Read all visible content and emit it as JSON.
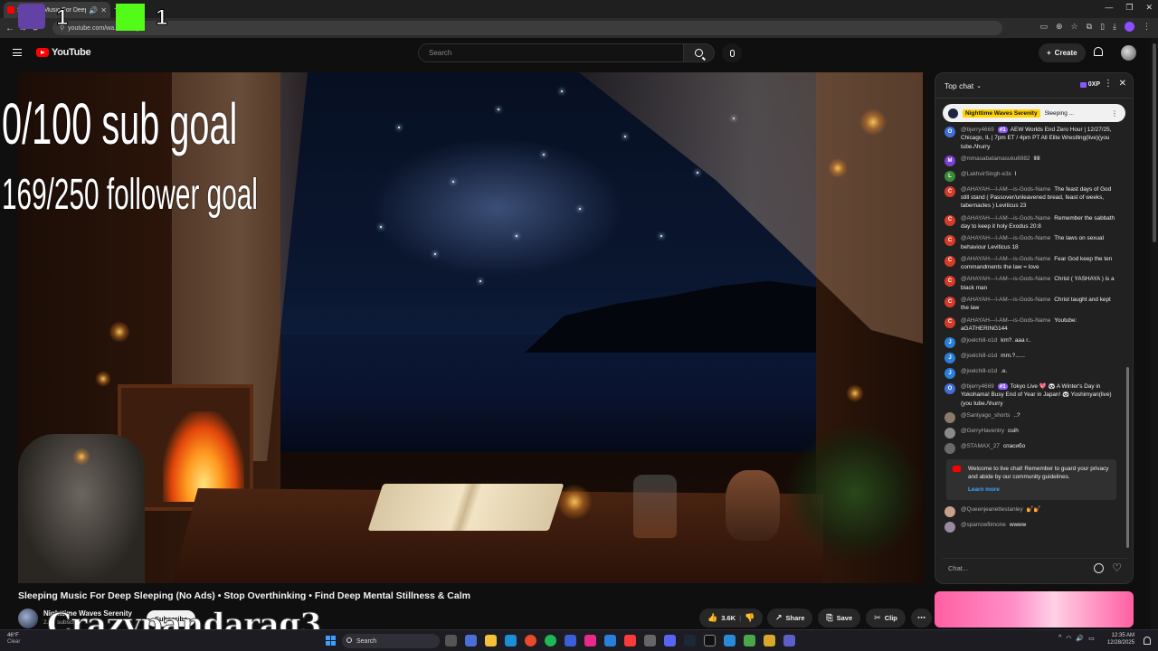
{
  "browser": {
    "tab_title": "Sleeping Music For Deep Sl",
    "url": "youtube.com/wa...UCl-i6y0",
    "window_controls": [
      "—",
      "❐",
      "✕"
    ]
  },
  "overlays": {
    "twitch_count": "1",
    "kick_count": "1",
    "sub_goal": "0/100 sub goal",
    "follower_goal": "169/250 follower goal",
    "watermark": "Crazypandarag3"
  },
  "header": {
    "logo_text": "YouTube",
    "search_placeholder": "Search",
    "create_label": "Create"
  },
  "video": {
    "title": "Sleeping Music For Deep Sleeping (No Ads) • Stop Overthinking • Find Deep Mental Stillness & Calm",
    "channel": "Nighttime Waves Serenity",
    "subscribers": "2.9K subscri",
    "subscribe_label": "Subscribe",
    "like_count": "3.6K",
    "share_label": "Share",
    "save_label": "Save",
    "clip_label": "Clip"
  },
  "chat": {
    "header_label": "Top chat",
    "xp_label": "0XP",
    "pinned": {
      "channel": "Nighttime Waves Serenity",
      "text": "Sleeping ..."
    },
    "messages": [
      {
        "initial": "O",
        "color": "#3f6fd8",
        "author": "@bjerry4669",
        "badge": "#1",
        "text": "AEW Worlds End Zero Hour | 12/27/25, Chicago, IL | 7pm ET / 4pm PT All Elite Wrestling(live)(you tube./\\hurry"
      },
      {
        "initial": "M",
        "color": "#7b3fd8",
        "author": "@mmasabatamasuku6982",
        "text": "lllll"
      },
      {
        "initial": "L",
        "color": "#3a8a3a",
        "author": "@LakhvirSingh-e3x",
        "text": "l"
      },
      {
        "initial": "C",
        "color": "#d83a2a",
        "author": "@AHAYAH---I-AM---is-Gods-Name",
        "text": "The feast days of God still stand ( Passover/unleavened bread, feast of weeks, tabernacles ) Leviticus 23"
      },
      {
        "initial": "C",
        "color": "#d83a2a",
        "author": "@AHAYAH---I-AM---is-Gods-Name",
        "text": "Remember the sabbath day to keep it holy Exodus 20:8"
      },
      {
        "initial": "C",
        "color": "#d83a2a",
        "author": "@AHAYAH---I-AM---is-Gods-Name",
        "text": "The laws on sexual behaviour Leviticus 18"
      },
      {
        "initial": "C",
        "color": "#d83a2a",
        "author": "@AHAYAH---I-AM---is-Gods-Name",
        "text": "Fear God keep the ten commandments the law = love"
      },
      {
        "initial": "C",
        "color": "#d83a2a",
        "author": "@AHAYAH---I-AM---is-Gods-Name",
        "text": "Christ ( YASHAYA ) is a black man"
      },
      {
        "initial": "C",
        "color": "#d83a2a",
        "author": "@AHAYAH---I-AM---is-Gods-Name",
        "text": "Christ taught and kept the law"
      },
      {
        "initial": "C",
        "color": "#d83a2a",
        "author": "@AHAYAH---I-AM---is-Gods-Name",
        "text": "Youtube: aGATHERING144"
      },
      {
        "initial": "J",
        "color": "#2a7fd8",
        "author": "@joelchill-o1d",
        "text": "km?. aaa r.."
      },
      {
        "initial": "J",
        "color": "#2a7fd8",
        "author": "@joelchill-o1d",
        "text": "mm.?......"
      },
      {
        "initial": "J",
        "color": "#2a7fd8",
        "author": "@joelchill-o1d",
        "text": ".e."
      },
      {
        "initial": "O",
        "color": "#3f6fd8",
        "author": "@bjerry4669",
        "badge": "#1",
        "text": "Tokyo Live 💖 🐼 A Winter's Day in Yokohama! Busy End of Year in Japan! 🐼 Yoshimyan(live)(you tube./\\hurry"
      },
      {
        "initial": "",
        "color": "#8a7a6a",
        "author": "@Santyago_shorts",
        "text": "..?"
      },
      {
        "initial": "",
        "color": "#8a8a8a",
        "author": "@GerryHaventry",
        "text": "cuih"
      },
      {
        "initial": "",
        "color": "#6a6a6a",
        "author": "@STAMAX_27",
        "text": "спасибо"
      }
    ],
    "system_message": "Welcome to live chat! Remember to guard your privacy and abide by our community guidelines.",
    "system_link": "Learn more",
    "after_messages": [
      {
        "initial": "",
        "color": "#c9a08a",
        "author": "@Queenjeanettestanley",
        "text": "💅💅"
      },
      {
        "initial": "",
        "color": "#9a8aa0",
        "author": "@sparrowfilmone",
        "text": "wwww"
      }
    ],
    "input_placeholder": "Chat..."
  },
  "taskbar": {
    "temp": "46°F",
    "condition": "Clear",
    "search_label": "Search",
    "time": "12:35 AM",
    "date": "12/28/2025"
  }
}
